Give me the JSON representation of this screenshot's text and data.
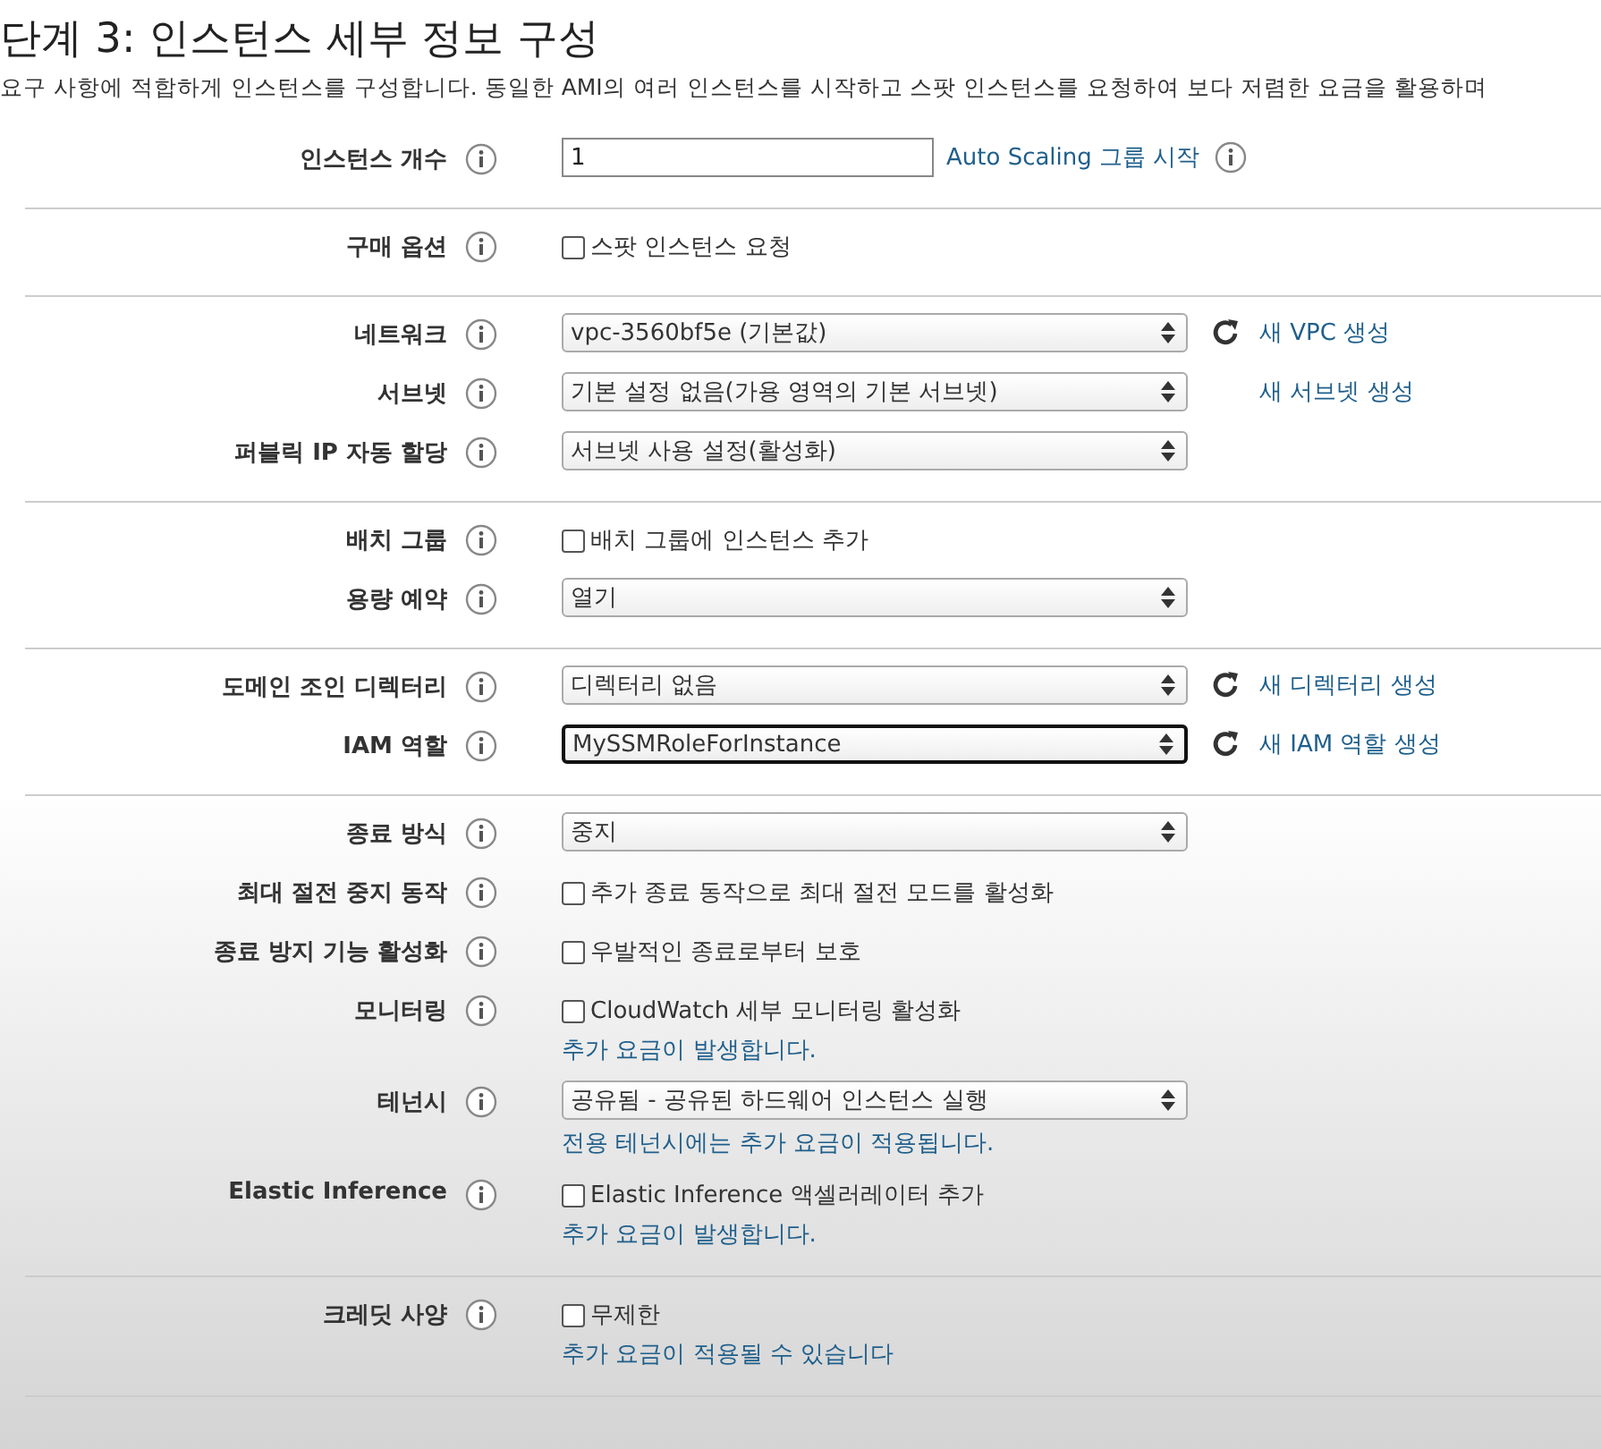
{
  "title": "단계 3: 인스턴스 세부 정보 구성",
  "description": "요구 사항에 적합하게 인스턴스를 구성합니다. 동일한 AMI의 여러 인스턴스를 시작하고 스팟 인스턴스를 요청하여 보다 저렴한 요금을 활용하며",
  "sections": [
    {
      "rows": [
        {
          "label": "인스턴스 개수",
          "kind": "input",
          "value": "1",
          "side": {
            "refresh": false,
            "link": "Auto Scaling 그룹 시작",
            "info": true
          }
        }
      ]
    },
    {
      "rows": [
        {
          "label": "구매 옵션",
          "kind": "checkbox",
          "checked": false,
          "text": "스팟 인스턴스 요청"
        }
      ]
    },
    {
      "rows": [
        {
          "label": "네트워크",
          "kind": "select",
          "value": "vpc-3560bf5e (기본값)",
          "focused": false,
          "side": {
            "refresh": true,
            "link": "새 VPC 생성",
            "info": false
          }
        },
        {
          "label": "서브넷",
          "kind": "select",
          "value": "기본 설정 없음(가용 영역의 기본 서브넷)",
          "focused": false,
          "side": {
            "refresh": false,
            "link": "새 서브넷 생성",
            "info": false
          }
        },
        {
          "label": "퍼블릭 IP 자동 할당",
          "kind": "select",
          "value": "서브넷 사용 설정(활성화)",
          "focused": false
        }
      ]
    },
    {
      "rows": [
        {
          "label": "배치 그룹",
          "kind": "checkbox",
          "checked": false,
          "text": "배치 그룹에 인스턴스 추가"
        },
        {
          "label": "용량 예약",
          "kind": "select",
          "value": "열기",
          "focused": false
        }
      ]
    },
    {
      "rows": [
        {
          "label": "도메인 조인 디렉터리",
          "kind": "select",
          "value": "디렉터리 없음",
          "focused": false,
          "side": {
            "refresh": true,
            "link": "새 디렉터리 생성",
            "info": false
          }
        },
        {
          "label": "IAM 역할",
          "kind": "select",
          "value": "MySSMRoleForInstance",
          "focused": true,
          "side": {
            "refresh": true,
            "link": "새 IAM 역할 생성",
            "info": false
          }
        }
      ]
    },
    {
      "rows": [
        {
          "label": "종료 방식",
          "kind": "select",
          "value": "중지",
          "focused": false
        },
        {
          "label": "최대 절전 중지 동작",
          "kind": "checkbox",
          "checked": false,
          "text": "추가 종료 동작으로 최대 절전 모드를 활성화"
        },
        {
          "label": "종료 방지 기능 활성화",
          "kind": "checkbox",
          "checked": false,
          "text": "우발적인 종료로부터 보호"
        },
        {
          "label": "모니터링",
          "kind": "checkbox",
          "checked": false,
          "text": "CloudWatch 세부 모니터링 활성화",
          "note": "추가 요금이 발생합니다."
        },
        {
          "label": "테넌시",
          "kind": "select",
          "value": "공유됨 - 공유된 하드웨어 인스턴스 실행",
          "focused": false,
          "note": "전용 테넌시에는 추가 요금이 적용됩니다."
        },
        {
          "label": "Elastic Inference",
          "kind": "checkbox",
          "checked": false,
          "text": "Elastic Inference 액셀러레이터 추가",
          "note": "추가 요금이 발생합니다."
        }
      ]
    },
    {
      "rows": [
        {
          "label": "크레딧 사양",
          "kind": "checkbox",
          "checked": false,
          "text": "무제한",
          "note": "추가 요금이 적용될 수 있습니다"
        }
      ]
    }
  ]
}
